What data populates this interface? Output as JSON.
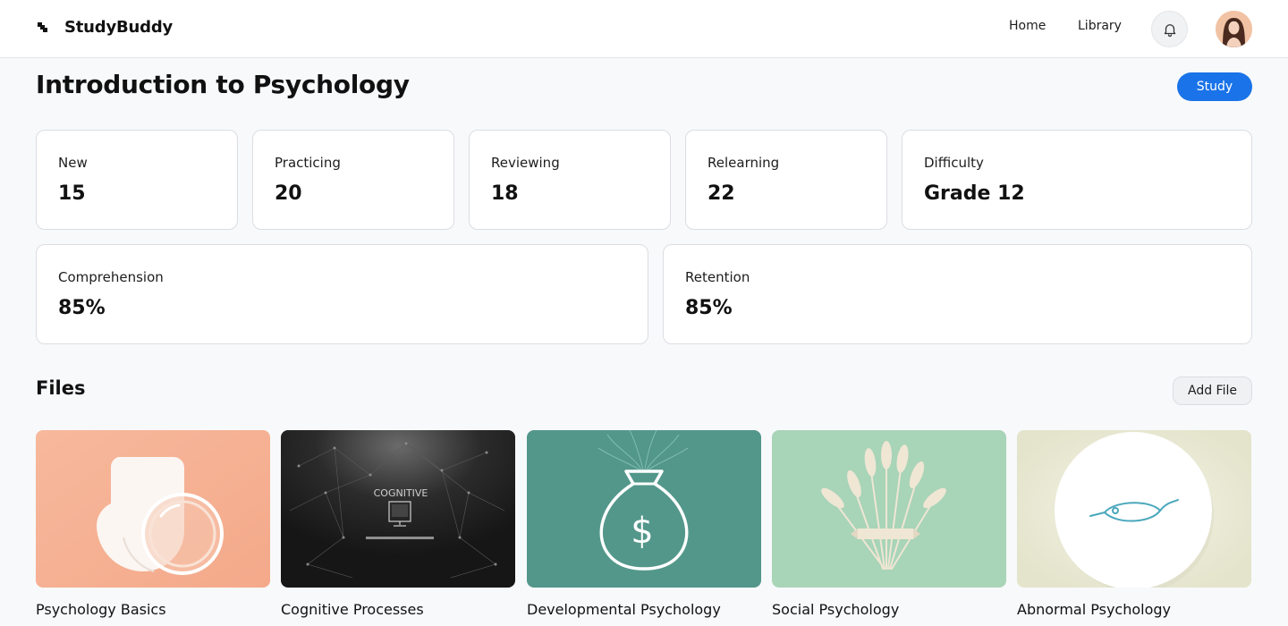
{
  "app": {
    "name": "StudyBuddy"
  },
  "nav": {
    "home": "Home",
    "library": "Library"
  },
  "header": {
    "title": "Introduction to Psychology",
    "study_label": "Study"
  },
  "stats": [
    {
      "label": "New",
      "value": "15"
    },
    {
      "label": "Practicing",
      "value": "20"
    },
    {
      "label": "Reviewing",
      "value": "18"
    },
    {
      "label": "Relearning",
      "value": "22"
    },
    {
      "label": "Difficulty",
      "value": "Grade 12"
    }
  ],
  "metrics": [
    {
      "label": "Comprehension",
      "value": "85%"
    },
    {
      "label": "Retention",
      "value": "85%"
    }
  ],
  "files": {
    "title": "Files",
    "add_label": "Add File",
    "items": [
      {
        "title": "Psychology Basics",
        "thumb_text": "",
        "thumb_subtext": "",
        "icon": "soap-bowl-image"
      },
      {
        "title": "Cognitive Processes",
        "thumb_text": "COGNITIVE",
        "thumb_subtext": "",
        "icon": "network-monitor-image"
      },
      {
        "title": "Developmental Psychology",
        "thumb_text": "$",
        "thumb_subtext": "",
        "icon": "money-bag-image"
      },
      {
        "title": "Social Psychology",
        "thumb_text": "",
        "thumb_subtext": "",
        "icon": "wheat-bouquet-image"
      },
      {
        "title": "Abnormal Psychology",
        "thumb_text": "",
        "thumb_subtext": "",
        "icon": "fish-plate-image"
      }
    ]
  },
  "colors": {
    "accent": "#1a73e8",
    "background": "#f8f9fb",
    "card_border": "#dcdde1"
  }
}
